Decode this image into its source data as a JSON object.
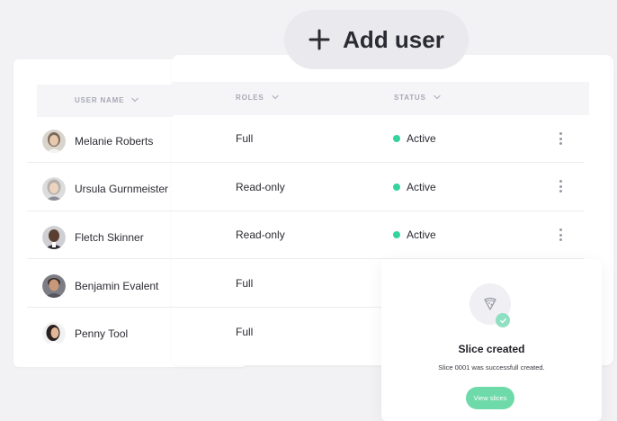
{
  "add_user": {
    "label": "Add user"
  },
  "table": {
    "columns": {
      "user_name": "USER NAME",
      "roles": "ROLES",
      "status": "STATUS"
    },
    "rows": [
      {
        "name": "Melanie Roberts",
        "role": "Full",
        "status": "Active"
      },
      {
        "name": "Ursula Gurnmeister",
        "role": "Read-only",
        "status": "Active"
      },
      {
        "name": "Fletch Skinner",
        "role": "Read-only",
        "status": "Active"
      },
      {
        "name": "Benjamin Evalent",
        "role": "Full",
        "status": ""
      },
      {
        "name": "Penny Tool",
        "role": "Full",
        "status": ""
      }
    ]
  },
  "toast": {
    "title": "Slice created",
    "message": "Slice 0001 was successfull created.",
    "button": "View slices"
  },
  "colors": {
    "status_active": "#35d39c",
    "toast_button": "#6edaa9",
    "background": "#f2f2f4"
  },
  "icons": {
    "add": "plus-icon",
    "sort": "chevron-down-icon",
    "menu": "kebab-menu-icon",
    "toast": "pizza-slice-icon",
    "check": "check-icon"
  }
}
